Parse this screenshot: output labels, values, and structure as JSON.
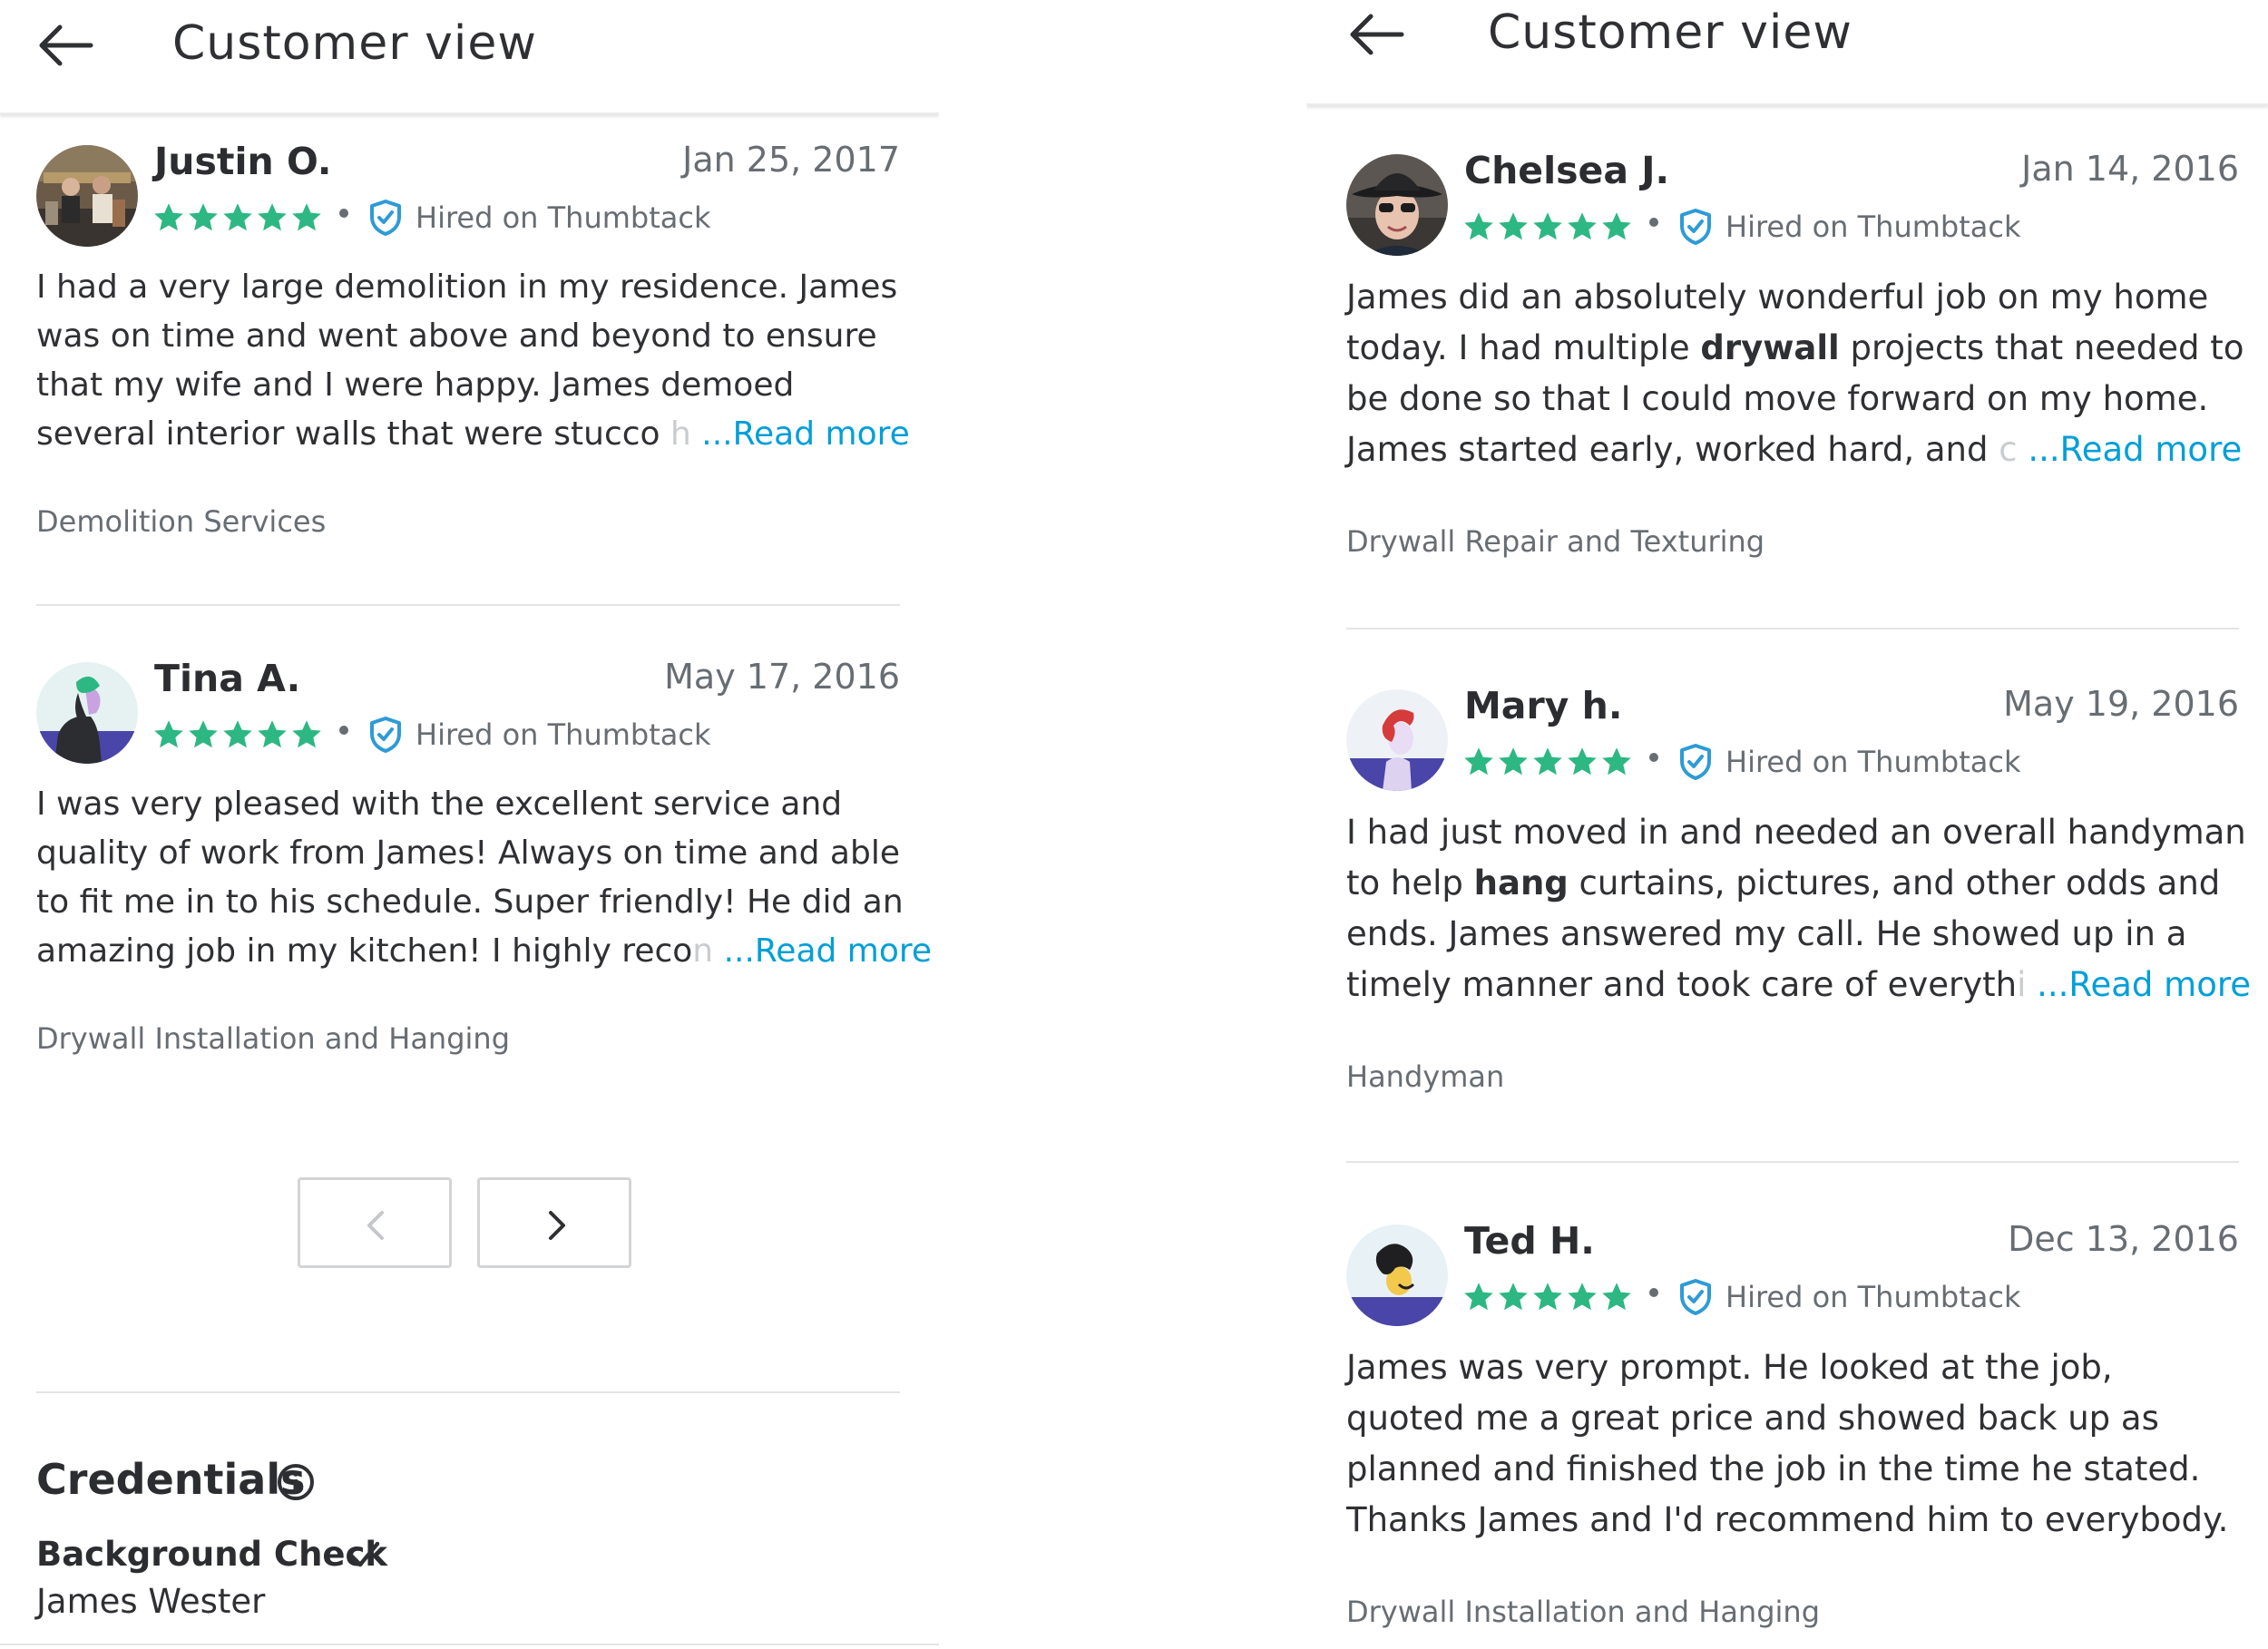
{
  "colors": {
    "star_green": "#2db783",
    "link_blue": "#009fd9",
    "badge_blue": "#2e9bd6",
    "text_dark": "#2f3033",
    "text_gray": "#676d73",
    "avatar_navy": "#4a45a8"
  },
  "left": {
    "title": "Customer view",
    "back_icon": "arrow-left-icon",
    "reviews": [
      {
        "name": "Justin O.",
        "date": "Jan 25, 2017",
        "rating": 5,
        "hired": "Hired on Thumbtack",
        "lines": [
          "I had a very large demolition in my residence. James",
          "was on time and went above and beyond to ensure",
          "that my wife and I were happy. James demoed",
          "several interior walls that were stucco "
        ],
        "fade": "h",
        "read_more": "...Read more",
        "category": "Demolition Services"
      },
      {
        "name": "Tina A.",
        "date": "May 17, 2016",
        "rating": 5,
        "hired": "Hired on Thumbtack",
        "lines": [
          "I was very pleased with the excellent service and",
          "quality of work from James! Always on time and able",
          "to fit me in to his schedule. Super friendly! He did an",
          "amazing job in my kitchen! I highly reco"
        ],
        "fade": "n",
        "read_more": "...Read more",
        "category": "Drywall Installation and Hanging"
      }
    ],
    "pager": {
      "prev_icon": "chevron-left-icon",
      "next_icon": "chevron-right-icon"
    },
    "credentials": {
      "title": "Credentials",
      "info_icon": "info-icon",
      "check_name": "Background Check",
      "check_icon": "checkmark-icon",
      "person": "James Wester"
    }
  },
  "right": {
    "title": "Customer view",
    "back_icon": "arrow-left-icon",
    "reviews": [
      {
        "name": "Chelsea J.",
        "date": "Jan 14, 2016",
        "rating": 5,
        "hired": "Hired on Thumbtack",
        "line1": "James did an absolutely wonderful job on my home",
        "line2_a": "today. I had multiple ",
        "line2_b": "drywall",
        "line2_c": " projects that needed to",
        "line3": "be done so that I could move forward on my home.",
        "line4": "James started early, worked hard, and ",
        "fade": "c",
        "read_more": "...Read more",
        "category": "Drywall Repair and Texturing"
      },
      {
        "name": "Mary h.",
        "date": "May 19, 2016",
        "rating": 5,
        "hired": "Hired on Thumbtack",
        "line1": "I had just moved in and needed an overall handyman",
        "line2_a": "to help ",
        "line2_b": "hang",
        "line2_c": " curtains, pictures, and other odds and",
        "line3": "ends. James answered my call. He showed up in a",
        "line4": "timely manner and took care of everyth",
        "fade": "i",
        "read_more": "...Read more",
        "category": "Handyman"
      },
      {
        "name": "Ted H.",
        "date": "Dec 13, 2016",
        "rating": 5,
        "hired": "Hired on Thumbtack",
        "lines": [
          "James was very prompt. He looked at the job,",
          "quoted me a great price and showed back up as",
          "planned and finished the job in the time he stated.",
          "Thanks James and I'd recommend him to everybody."
        ],
        "category": "Drywall Installation and Hanging"
      }
    ]
  }
}
